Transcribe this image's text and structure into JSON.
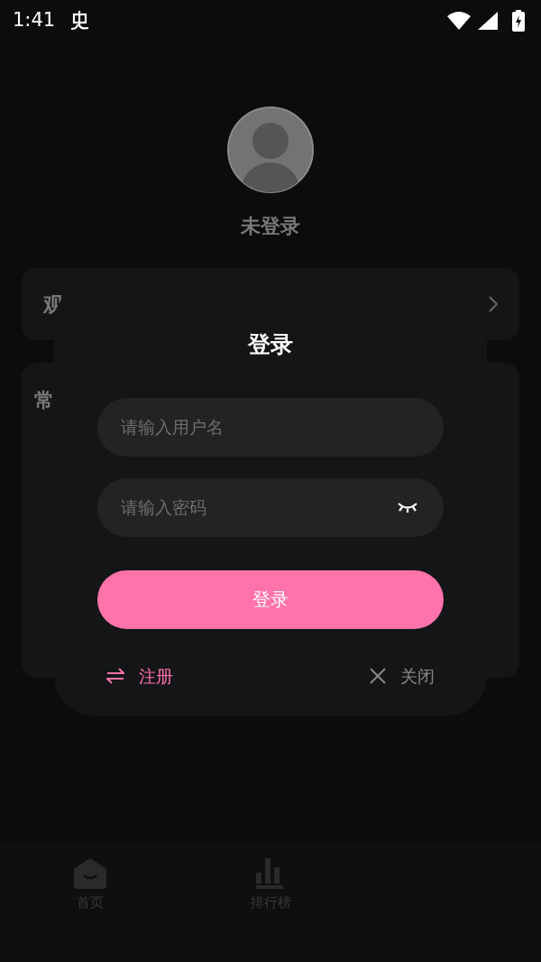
{
  "status_bar": {
    "time": "1:41"
  },
  "profile": {
    "name": "未登录"
  },
  "menu_cards": [
    {
      "label": "观"
    },
    {
      "label": "常"
    }
  ],
  "login_dialog": {
    "title": "登录",
    "username": {
      "placeholder": "请输入用户名"
    },
    "password": {
      "placeholder": "请输入密码",
      "visible": false
    },
    "submit": "登录",
    "register": "注册",
    "close": "关闭"
  },
  "bottom_nav": [
    {
      "label": "首页",
      "kind": "home"
    },
    {
      "label": "排行榜",
      "kind": "chart"
    }
  ]
}
